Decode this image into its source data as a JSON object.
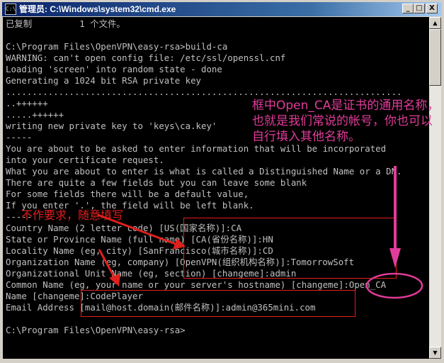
{
  "window": {
    "title": "管理员: C:\\Windows\\system32\\cmd.exe",
    "icon": "cmd-icon",
    "buttons": {
      "minimize": "_",
      "maximize": "□",
      "close": "X"
    }
  },
  "console_lines": [
    "已复制         1 个文件。",
    "",
    "C:\\Program Files\\OpenVPN\\easy-rsa>build-ca",
    "WARNING: can't open config file: /etc/ssl/openssl.cnf",
    "Loading 'screen' into random state - done",
    "Generating a 1024 bit RSA private key",
    "...........................................................................",
    "..++++++",
    ".....++++++",
    "writing new private key to 'keys\\ca.key'",
    "-----",
    "You are about to be asked to enter information that will be incorporated",
    "into your certificate request.",
    "What you are about to enter is what is called a Distinguished Name or a DN.",
    "There are quite a few fields but you can leave some blank",
    "For some fields there will be a default value,",
    "If you enter '.', the field will be left blank.",
    "-----",
    "Country Name (2 letter code) [US(国家名称)]:CA",
    "State or Province Name (full name) [CA(省份名称)]:HN",
    "Locality Name (eg, city) [SanFrancisco(城市名称)]:CD",
    "Organization Name (eg, company) [OpenVPN(组织机构名称)]:TomorrowSoft",
    "Organizational Unit Name (eg, section) [changeme]:admin",
    "Common Name (eg, your name or your server's hostname) [changeme]:Open_CA",
    "Name [changeme]:CodePlayer",
    "Email Address [mail@host.domain(邮件名称)]:admin@365mini.com",
    "",
    "C:\\Program Files\\OpenVPN\\easy-rsa>"
  ],
  "annotations": {
    "common_name_note": "框中Open_CA是证书的通用名称，也就是我们常说的帐号，你也可以自行填入其他名称。",
    "free_fill_note": "不作要求，随意填写"
  },
  "colors": {
    "console_bg": "#000000",
    "console_text": "#c0c0c0",
    "title_bar": "#0a246a",
    "annotation_pink": "#e23b9a",
    "annotation_red": "#e0201c"
  }
}
